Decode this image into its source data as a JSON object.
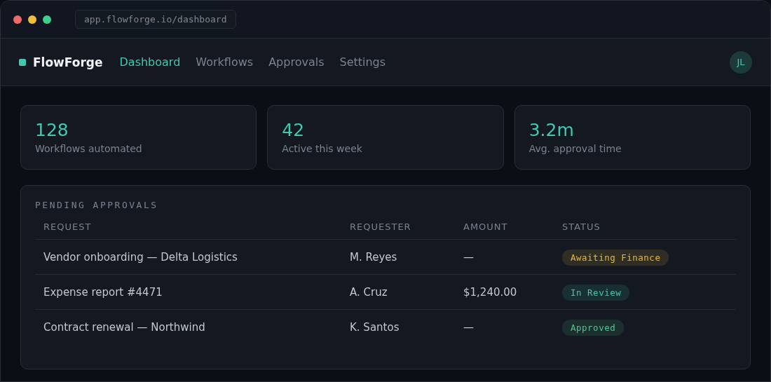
{
  "window": {
    "url": "app.flowforge.io/dashboard"
  },
  "nav": {
    "brand": "FlowForge",
    "items": [
      {
        "label": "Dashboard",
        "selected": true
      },
      {
        "label": "Workflows",
        "selected": false
      },
      {
        "label": "Approvals",
        "selected": false
      },
      {
        "label": "Settings",
        "selected": false
      }
    ],
    "avatar": "JL"
  },
  "stats": [
    {
      "value": "128",
      "label": "Workflows automated"
    },
    {
      "value": "42",
      "label": "Active this week"
    },
    {
      "value": "3.2m",
      "label": "Avg. approval time"
    }
  ],
  "approvals": {
    "title": "PENDING APPROVALS",
    "columns": [
      "REQUEST",
      "REQUESTER",
      "AMOUNT",
      "STATUS"
    ],
    "rows": [
      {
        "request": "Vendor onboarding — Delta Logistics",
        "requester": "M. Reyes",
        "amount": "—",
        "status": {
          "label": "Awaiting Finance",
          "color": "#e5b83c"
        }
      },
      {
        "request": "Expense report #4471",
        "requester": "A. Cruz",
        "amount": "$1,240.00",
        "status": {
          "label": "In Review",
          "color": "#3ec9b0"
        }
      },
      {
        "request": "Contract renewal — Northwind",
        "requester": "K. Santos",
        "amount": "—",
        "status": {
          "label": "Approved",
          "color": "#4cc98a"
        }
      }
    ]
  }
}
